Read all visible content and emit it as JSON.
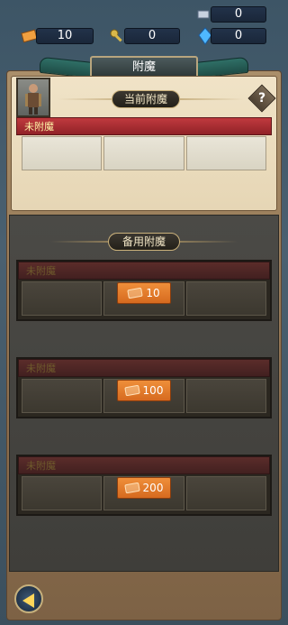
{
  "resources": {
    "weapon": "0",
    "ticket": "10",
    "key": "0",
    "crystal": "0"
  },
  "panel": {
    "title": "附魔"
  },
  "current": {
    "section_title": "当前附魔",
    "help_label": "?",
    "slot_label": "未附魔"
  },
  "backup": {
    "section_title": "备用附魔",
    "slots": [
      {
        "label": "未附魔",
        "cost": "10"
      },
      {
        "label": "未附魔",
        "cost": "100"
      },
      {
        "label": "未附魔",
        "cost": "200"
      }
    ]
  },
  "icons": {
    "back": "back-arrow-icon",
    "ticket": "ticket-icon",
    "key": "key-icon",
    "crystal": "crystal-icon",
    "weapon": "weapon-icon"
  }
}
